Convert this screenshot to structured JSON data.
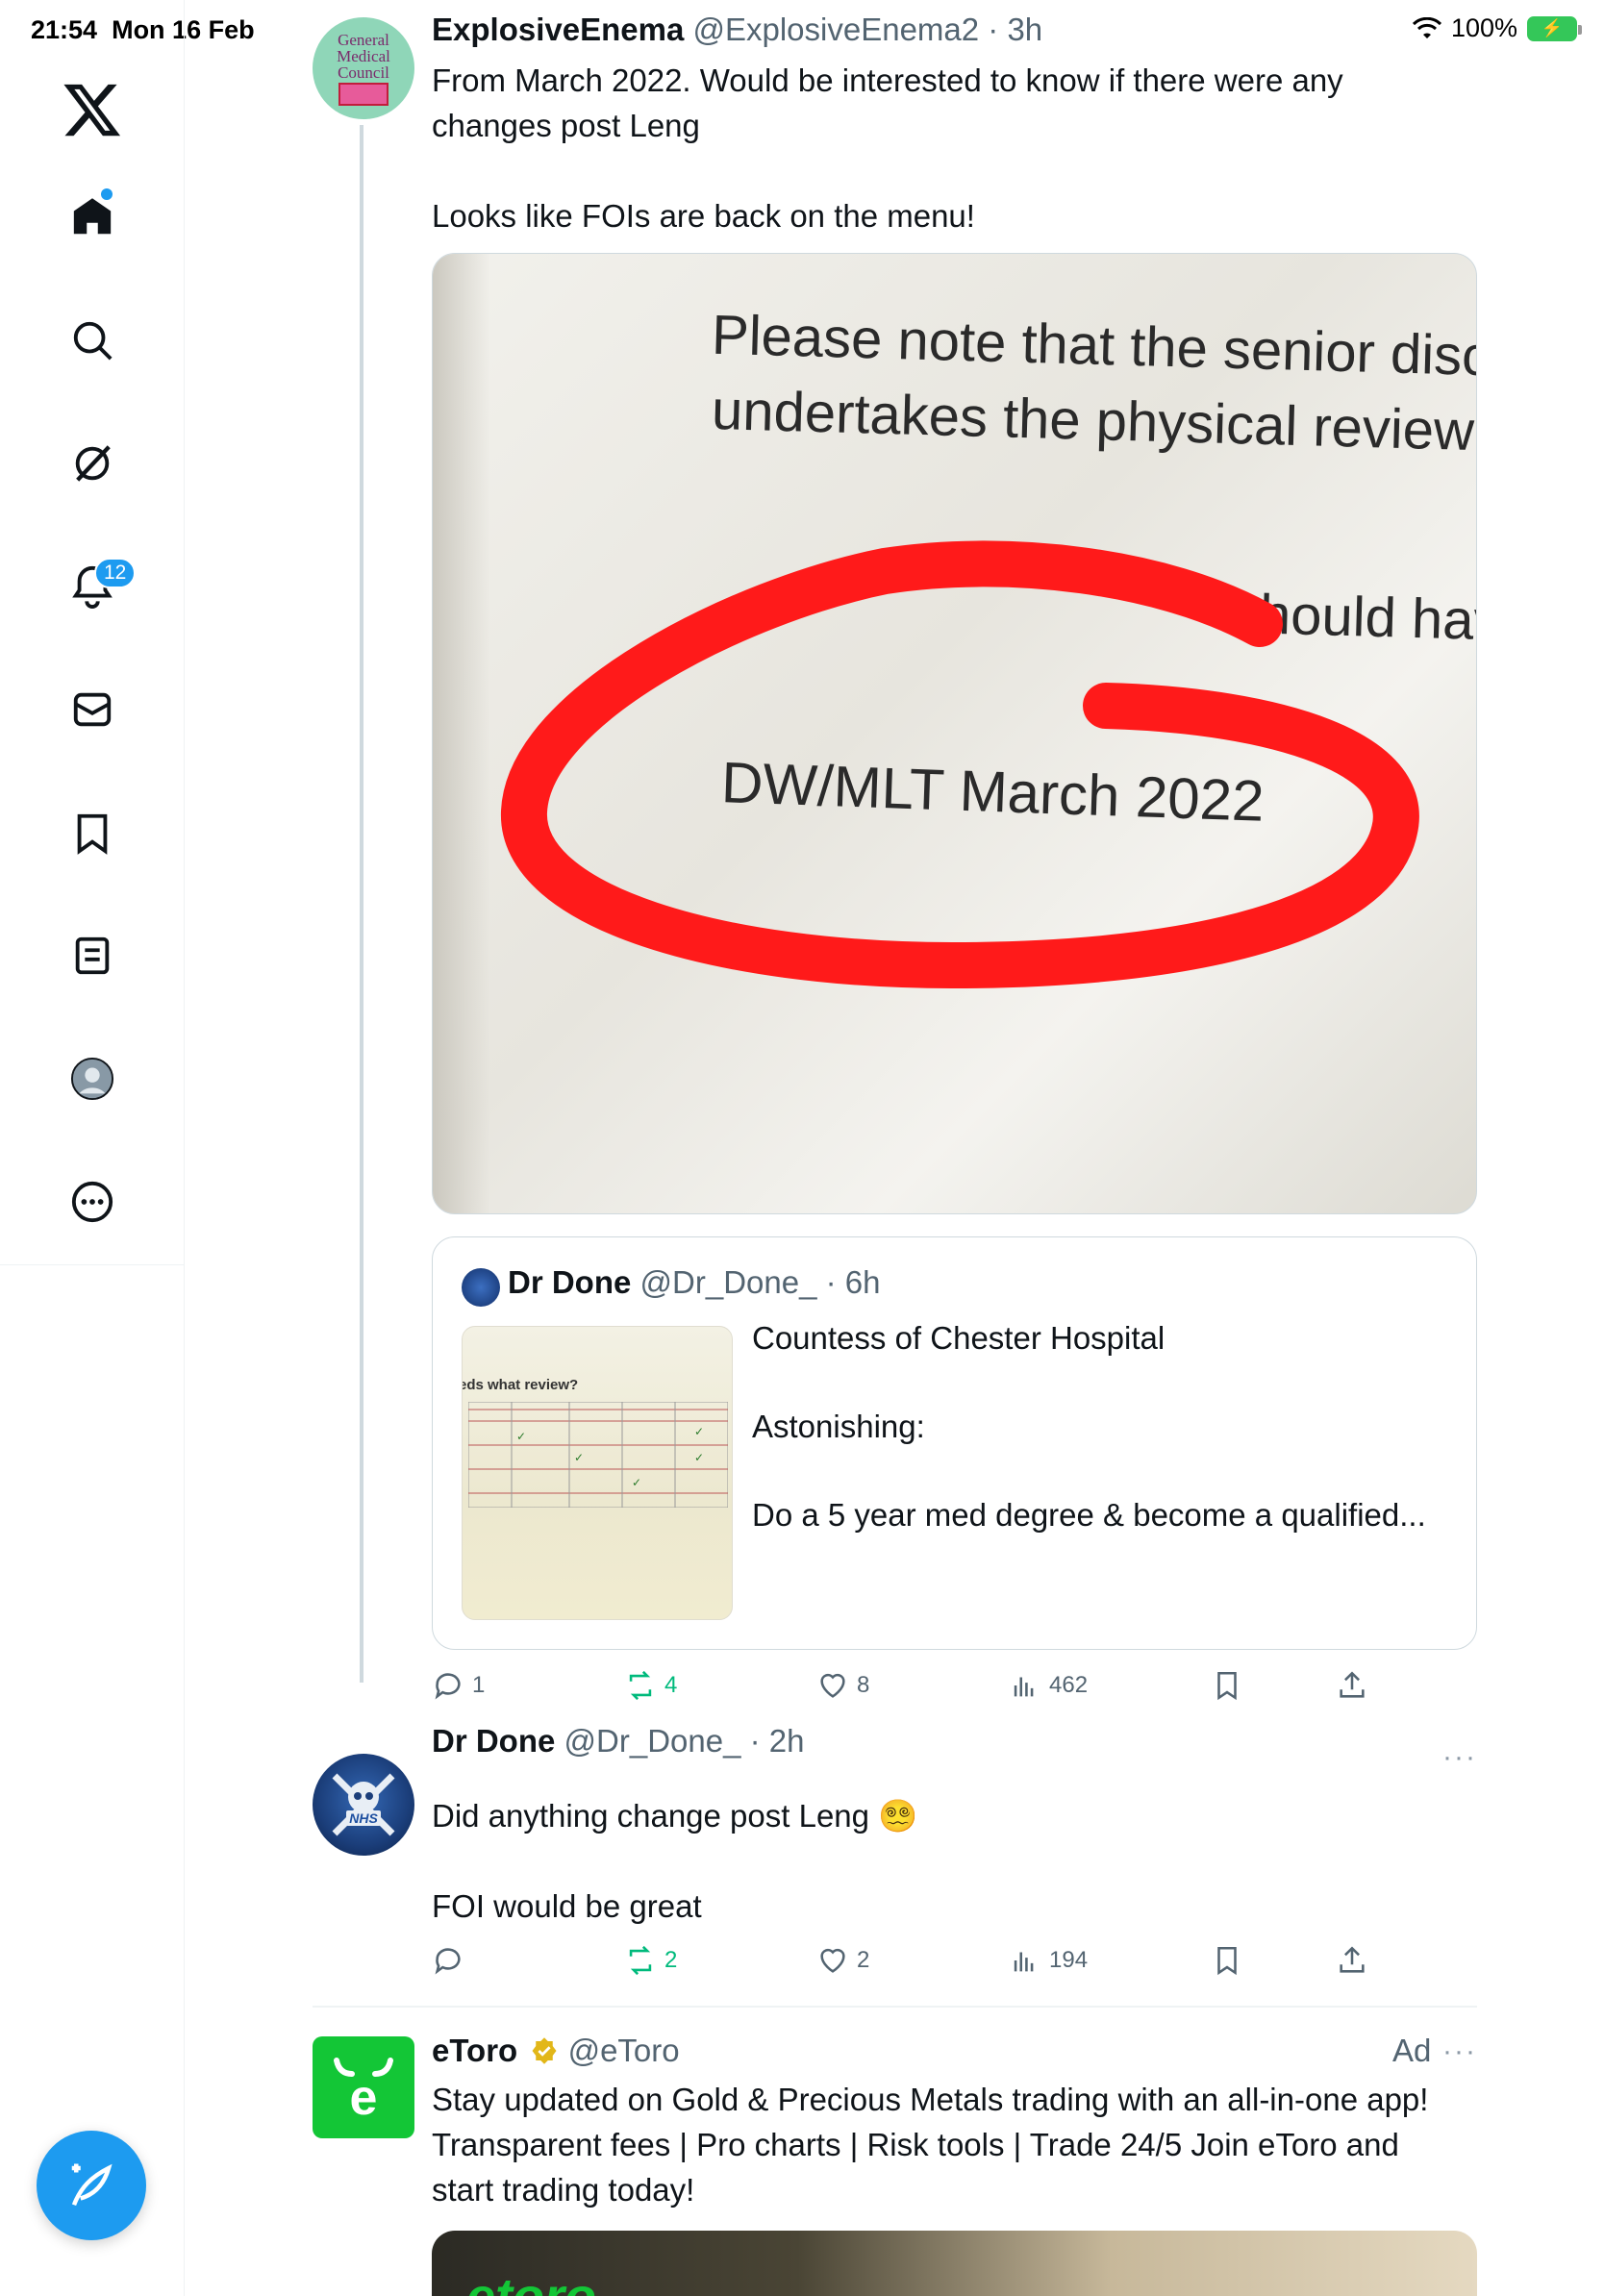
{
  "status": {
    "time": "21:54",
    "date": "Mon 16 Feb",
    "battery": "100%"
  },
  "sidebar": {
    "notifications_badge": "12"
  },
  "tweet1": {
    "name": "ExplosiveEnema",
    "handle": "@ExplosiveEnema2",
    "time": "· 3h",
    "text_line1": "From March 2022. Would be interested to know if  there were any changes post Leng",
    "text_line2": "Looks like FOIs are back on the menu!",
    "media_text_1": "Please note that the senior disc",
    "media_text_2": "undertakes the physical review",
    "media_text_3": "hould hav",
    "media_text_4": "DW/MLT March 2022",
    "avatar_text": [
      "General",
      "Medical",
      "Council"
    ],
    "replies": "1",
    "reposts": "4",
    "likes": "8",
    "views": "462"
  },
  "quote": {
    "name": "Dr Done",
    "handle": "@Dr_Done_",
    "time": "· 6h",
    "line1": "Countess of Chester Hospital",
    "line2": "Astonishing:",
    "line3": "Do a 5 year med degree & become a qualified...",
    "thumb_title": "eds what review?"
  },
  "tweet2": {
    "name": "Dr Done",
    "handle": "@Dr_Done_",
    "time": "· 2h",
    "text_line1": "Did anything change post Leng",
    "emoji": "😵‍💫",
    "text_line2": "FOI would be great",
    "avatar_text": "NHS",
    "replies": "",
    "reposts": "2",
    "likes": "2",
    "views": "194",
    "more": "···"
  },
  "ad": {
    "name": "eToro",
    "handle": "@eToro",
    "label": "Ad",
    "more": "···",
    "text_line1": "Stay updated on Gold & Precious Metals trading with an all-in-one app!",
    "text_line2": "Transparent fees | Pro charts | Risk tools | Trade 24/5 Join eToro and",
    "text_line3": "start trading today!",
    "logo_letter": "e",
    "media_logo": "etoro"
  },
  "colors": {
    "accent": "#1d9bf0",
    "repost": "#00ba7c",
    "muted": "#536471",
    "circle": "#ff1a1a",
    "etoro": "#13c636"
  },
  "icons": [
    "x-logo-icon",
    "home-icon",
    "search-icon",
    "grok-icon",
    "bell-icon",
    "mail-icon",
    "bookmark-icon",
    "lists-icon",
    "profile-icon",
    "more-icon",
    "compose-icon",
    "reply-icon",
    "repost-icon",
    "like-icon",
    "views-icon",
    "share-icon",
    "verified-icon",
    "wifi-icon",
    "battery-icon"
  ]
}
